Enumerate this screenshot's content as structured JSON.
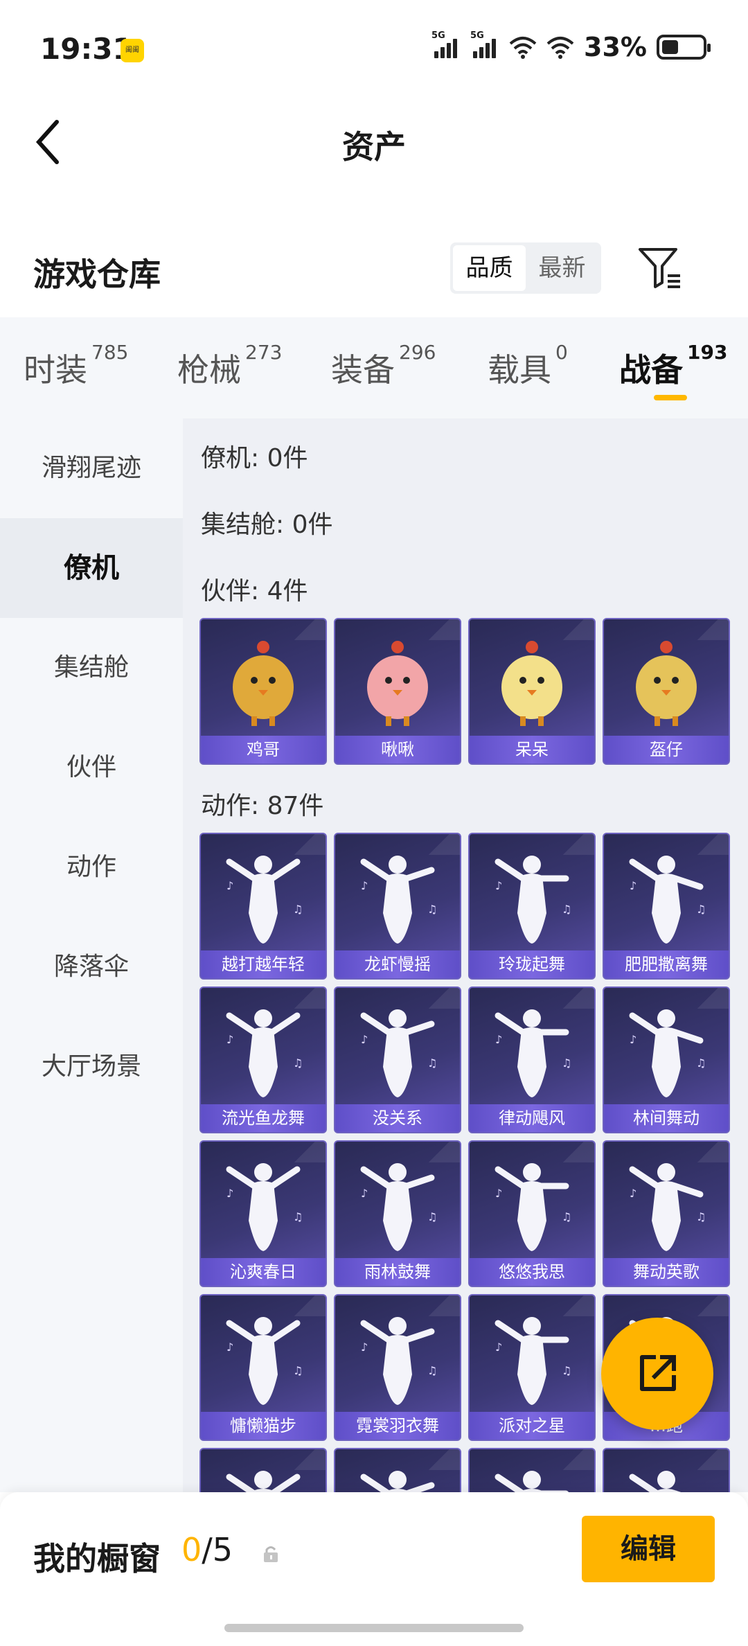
{
  "status_bar": {
    "time": "19:31",
    "badge": "阖阖",
    "signal1": "5G",
    "signal2": "5G",
    "battery": "33%"
  },
  "header": {
    "title": "资产"
  },
  "warehouse": {
    "title": "游戏仓库",
    "sort_options": [
      "品质",
      "最新"
    ],
    "active_sort": "品质"
  },
  "tabs": [
    {
      "label": "时装",
      "count": "785"
    },
    {
      "label": "枪械",
      "count": "273"
    },
    {
      "label": "装备",
      "count": "296"
    },
    {
      "label": "载具",
      "count": "0"
    },
    {
      "label": "战备",
      "count": "193"
    }
  ],
  "sidebar": {
    "items": [
      "滑翔尾迹",
      "僚机",
      "集结舱",
      "伙伴",
      "动作",
      "降落伞",
      "大厅场景"
    ],
    "active": "僚机"
  },
  "sections": {
    "wingman": "僚机: 0件",
    "capsule": "集结舱: 0件",
    "partner": "伙伴: 4件",
    "emote": "动作: 87件"
  },
  "partners": [
    "鸡哥",
    "啾啾",
    "呆呆",
    "盔仔"
  ],
  "emotes": [
    "越打越年轻",
    "龙虾慢摇",
    "玲珑起舞",
    "肥肥撒离舞",
    "流光鱼龙舞",
    "没关系",
    "律动飓风",
    "林间舞动",
    "沁爽春日",
    "雨林鼓舞",
    "悠悠我思",
    "舞动英歌",
    "慵懒猫步",
    "霓裳羽衣舞",
    "派对之星",
    "…跑"
  ],
  "bottom": {
    "showcase_title": "我的橱窗",
    "showcase_current": "0",
    "showcase_total": "/5",
    "edit_label": "编辑"
  },
  "colors": {
    "accent": "#ffb400",
    "card_bg": "#3b3875",
    "card_label": "#6b58d8"
  }
}
